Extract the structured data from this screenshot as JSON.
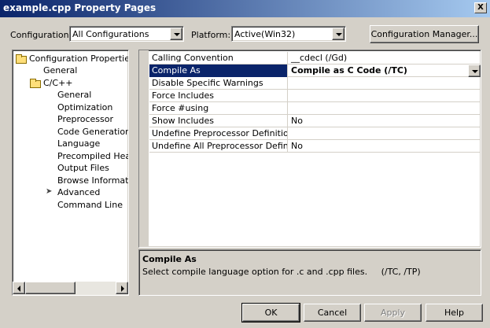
{
  "window": {
    "title": "example.cpp Property Pages",
    "close_glyph": "X"
  },
  "config": {
    "configuration_label": "Configuration:",
    "configuration_value": "All Configurations",
    "platform_label": "Platform:",
    "platform_value": "Active(Win32)",
    "manager_button": "Configuration Manager..."
  },
  "tree": {
    "root": "Configuration Properties",
    "items": [
      {
        "label": "General",
        "level": 1
      },
      {
        "label": "C/C++",
        "level": 1,
        "folder": true
      },
      {
        "label": "General",
        "level": 2
      },
      {
        "label": "Optimization",
        "level": 2
      },
      {
        "label": "Preprocessor",
        "level": 2
      },
      {
        "label": "Code Generation",
        "level": 2
      },
      {
        "label": "Language",
        "level": 2
      },
      {
        "label": "Precompiled Heade",
        "level": 2
      },
      {
        "label": "Output Files",
        "level": 2
      },
      {
        "label": "Browse Informatior",
        "level": 2
      },
      {
        "label": "Advanced",
        "level": 2,
        "current": true
      },
      {
        "label": "Command Line",
        "level": 2
      }
    ]
  },
  "grid": {
    "rows": [
      {
        "name": "Calling Convention",
        "value": "__cdecl (/Gd)"
      },
      {
        "name": "Compile As",
        "value": "Compile as C Code (/TC)",
        "selected": true
      },
      {
        "name": "Disable Specific Warnings",
        "value": ""
      },
      {
        "name": "Force Includes",
        "value": ""
      },
      {
        "name": "Force #using",
        "value": ""
      },
      {
        "name": "Show Includes",
        "value": "No"
      },
      {
        "name": "Undefine Preprocessor Definitions",
        "value": ""
      },
      {
        "name": "Undefine All Preprocessor Definitions",
        "value": "No"
      }
    ]
  },
  "description": {
    "title": "Compile As",
    "text": "Select compile language option for .c and .cpp files.     (/TC, /TP)"
  },
  "buttons": {
    "ok": "OK",
    "cancel": "Cancel",
    "apply": "Apply",
    "help": "Help"
  },
  "icons": {
    "folder": "folder-open-icon",
    "pointer": "pointer-arrow-icon",
    "dropdown": "chevron-down-icon"
  },
  "colors": {
    "title_start": "#0a246a",
    "title_end": "#a6caf0",
    "selection": "#0a246a",
    "face": "#d4d0c8"
  }
}
